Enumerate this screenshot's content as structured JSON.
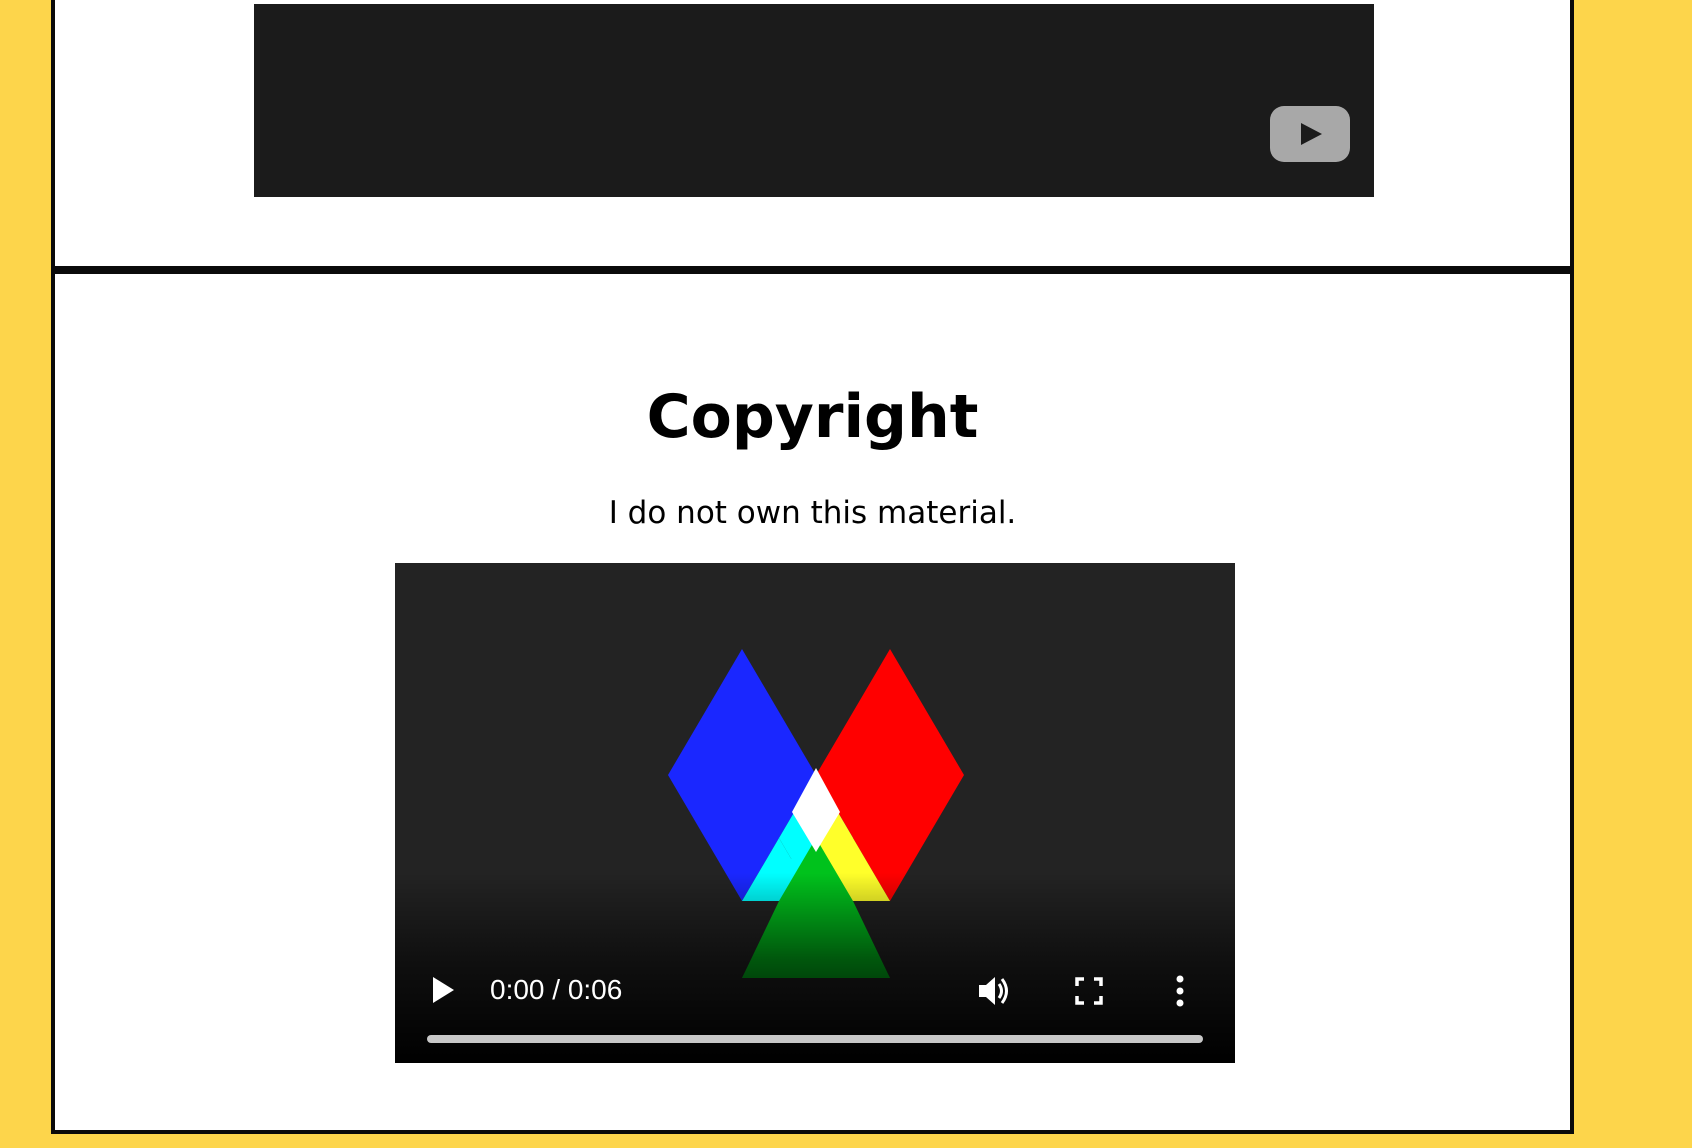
{
  "copyright": {
    "heading": "Copyright",
    "text": "I do not own this material."
  },
  "youtube_embed": {
    "icon": "youtube-play-icon"
  },
  "video_player": {
    "time_display": "0:00 / 0:06",
    "current_time": "0:00",
    "duration": "0:06",
    "progress_fraction": 0,
    "icons": {
      "play": "play-icon",
      "volume": "volume-icon",
      "fullscreen": "fullscreen-icon",
      "more": "more-options-icon"
    }
  },
  "colors": {
    "page_background": "#fdd54b",
    "panel_background": "#ffffff",
    "panel_border": "#0a0a0a",
    "embed_background": "#1b1b1b",
    "video_background": "#232323",
    "diamond_blue": "#1a27ff",
    "diamond_red": "#ff0000",
    "overlap_cyan": "#00ffff",
    "overlap_yellow": "#ffff2a",
    "overlap_green": "#00c21c",
    "overlap_white": "#ffffff"
  }
}
